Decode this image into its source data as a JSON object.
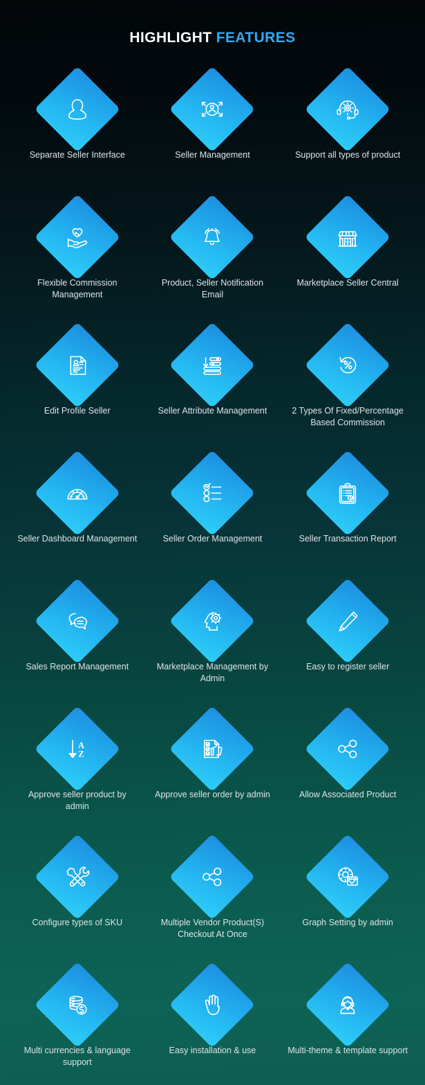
{
  "header": {
    "title_part1": "HIGHLIGHT",
    "title_part2": "FEATURES",
    "title_color_1": "#ffffff",
    "title_color_2": "#35a8f0"
  },
  "theme": {
    "background_top": "#020609",
    "background_bottom": "#0e6356",
    "diamond_gradient_start": "#1e8fe0",
    "diamond_gradient_end": "#2ecdf8",
    "icon_color": "#ffffff",
    "label_color": "#dfe3e5"
  },
  "features": [
    {
      "label": "Separate Seller Interface",
      "icon": "user-icon"
    },
    {
      "label": "Seller Management",
      "icon": "user-expand-arrows-icon"
    },
    {
      "label": "Support all types of product",
      "icon": "headset-gear-icon"
    },
    {
      "label": "Flexible Commission Management",
      "icon": "hand-heart-percent-icon"
    },
    {
      "label": "Product, Seller Notification Email",
      "icon": "bell-icon"
    },
    {
      "label": "Marketplace Seller Central",
      "icon": "storefront-icon"
    },
    {
      "label": "Edit Profile Seller",
      "icon": "profile-document-icon"
    },
    {
      "label": "Seller Attribute Management",
      "icon": "sort-list-down-icon"
    },
    {
      "label": "2 Types Of Fixed/Percentage Based Commission",
      "icon": "circular-arrow-percent-icon"
    },
    {
      "label": "Seller Dashboard Management",
      "icon": "speedometer-icon"
    },
    {
      "label": "Seller Order Management",
      "icon": "checklist-icon"
    },
    {
      "label": "Seller Transaction Report",
      "icon": "clipboard-report-icon"
    },
    {
      "label": "Sales Report Management",
      "icon": "chat-bubbles-icon"
    },
    {
      "label": "Marketplace Management by Admin",
      "icon": "head-gear-icon"
    },
    {
      "label": "Easy to register seller",
      "icon": "pencil-icon"
    },
    {
      "label": "Approve seller product by admin",
      "icon": "sort-a-z-icon"
    },
    {
      "label": "Approve seller order by admin",
      "icon": "checklist-thumbsup-icon"
    },
    {
      "label": "Allow Associated Product",
      "icon": "share-network-icon"
    },
    {
      "label": "Configure types of SKU",
      "icon": "tools-wrench-screwdriver-icon"
    },
    {
      "label": "Multiple Vendor Product(S) Checkout At Once",
      "icon": "share-network-icon"
    },
    {
      "label": "Graph Setting by admin",
      "icon": "gear-window-check-icon"
    },
    {
      "label": "Multi currencies & language support",
      "icon": "coins-dollar-icon"
    },
    {
      "label": "Easy installation & use",
      "icon": "hand-open-icon"
    },
    {
      "label": "Multi-theme & template support",
      "icon": "support-agent-icon"
    }
  ]
}
